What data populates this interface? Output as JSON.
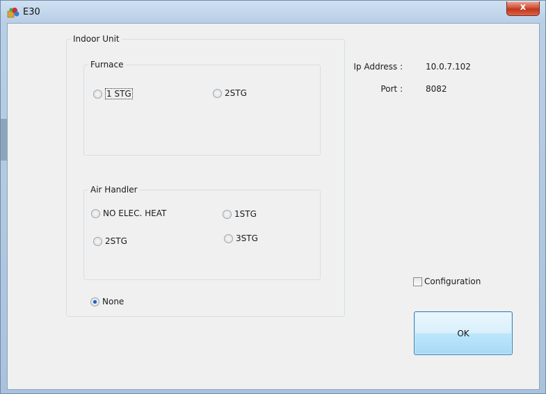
{
  "window": {
    "title": "E30",
    "close_glyph": "x"
  },
  "indoor_unit": {
    "label": "Indoor Unit",
    "furnace": {
      "label": "Furnace",
      "options": [
        {
          "label": "1 STG",
          "checked": false
        },
        {
          "label": "2STG",
          "checked": false
        }
      ]
    },
    "air_handler": {
      "label": "Air Handler",
      "options": [
        {
          "label": "NO ELEC. HEAT",
          "checked": false
        },
        {
          "label": "1STG",
          "checked": false
        },
        {
          "label": "2STG",
          "checked": false
        },
        {
          "label": "3STG",
          "checked": false
        }
      ]
    },
    "none_option": {
      "label": "None",
      "checked": true
    }
  },
  "connection": {
    "ip_label": "Ip Address :",
    "ip_value": "10.0.7.102",
    "port_label": "Port :",
    "port_value": "8082"
  },
  "configuration": {
    "label": "Configuration",
    "checked": false
  },
  "ok_button": {
    "label": "OK"
  },
  "colors": {
    "title_bar": "#b9cfe6",
    "close_button": "#c0361c",
    "client_bg": "#f0f0f0",
    "radio_selected": "#1c5fb8"
  },
  "icons": {
    "app": "app-icon",
    "close": "close-icon"
  }
}
